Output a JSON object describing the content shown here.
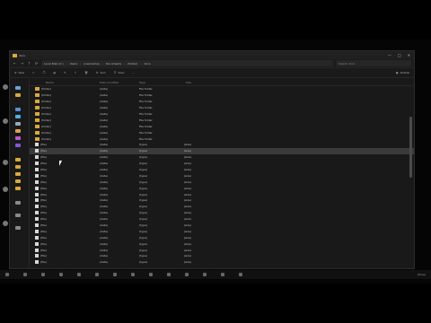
{
  "window": {
    "title": "docs",
    "min": "—",
    "max": "□",
    "close": "✕"
  },
  "address": {
    "back": "←",
    "forward": "→",
    "up": "↑",
    "refresh": "⟳",
    "crumbs": [
      "Local Disk (C:)",
      "Users",
      "(username)",
      "Documents",
      "(folder)",
      "docs"
    ],
    "search_placeholder": "Search docs"
  },
  "toolbar": {
    "new": "New",
    "sort": "Sort",
    "view": "View",
    "more": "···",
    "details": "Details"
  },
  "columns": {
    "name": "Name",
    "date": "Date modified",
    "type": "Type",
    "size": "Size"
  },
  "files": [
    {
      "kind": "folder",
      "name": "(folder)",
      "date": "(date)",
      "type": "File folder",
      "size": ""
    },
    {
      "kind": "folder",
      "name": "(folder)",
      "date": "(date)",
      "type": "File folder",
      "size": ""
    },
    {
      "kind": "folder",
      "name": "(folder)",
      "date": "(date)",
      "type": "File folder",
      "size": ""
    },
    {
      "kind": "folder",
      "name": "(folder)",
      "date": "(date)",
      "type": "File folder",
      "size": ""
    },
    {
      "kind": "folder",
      "name": "(folder)",
      "date": "(date)",
      "type": "File folder",
      "size": ""
    },
    {
      "kind": "folder",
      "name": "(folder)",
      "date": "(date)",
      "type": "File folder",
      "size": ""
    },
    {
      "kind": "folder",
      "name": "(folder)",
      "date": "(date)",
      "type": "File folder",
      "size": ""
    },
    {
      "kind": "folder",
      "name": "(folder)",
      "date": "(date)",
      "type": "File folder",
      "size": ""
    },
    {
      "kind": "folder",
      "name": "(folder)",
      "date": "(date)",
      "type": "File folder",
      "size": ""
    },
    {
      "kind": "file",
      "name": "(file)",
      "date": "(date)",
      "type": "(type)",
      "size": "(size)"
    },
    {
      "kind": "file",
      "name": "(file)",
      "date": "(date)",
      "type": "(type)",
      "size": "(size)",
      "selected": true
    },
    {
      "kind": "file",
      "name": "(file)",
      "date": "(date)",
      "type": "(type)",
      "size": "(size)"
    },
    {
      "kind": "file",
      "name": "(file)",
      "date": "(date)",
      "type": "(type)",
      "size": "(size)"
    },
    {
      "kind": "file",
      "name": "(file)",
      "date": "(date)",
      "type": "(type)",
      "size": "(size)"
    },
    {
      "kind": "file",
      "name": "(file)",
      "date": "(date)",
      "type": "(type)",
      "size": "(size)"
    },
    {
      "kind": "file",
      "name": "(file)",
      "date": "(date)",
      "type": "(type)",
      "size": "(size)"
    },
    {
      "kind": "file",
      "name": "(file)",
      "date": "(date)",
      "type": "(type)",
      "size": "(size)"
    },
    {
      "kind": "file",
      "name": "(file)",
      "date": "(date)",
      "type": "(type)",
      "size": "(size)"
    },
    {
      "kind": "file",
      "name": "(file)",
      "date": "(date)",
      "type": "(type)",
      "size": "(size)"
    },
    {
      "kind": "file",
      "name": "(file)",
      "date": "(date)",
      "type": "(type)",
      "size": "(size)"
    },
    {
      "kind": "file",
      "name": "(file)",
      "date": "(date)",
      "type": "(type)",
      "size": "(size)"
    },
    {
      "kind": "file",
      "name": "(file)",
      "date": "(date)",
      "type": "(type)",
      "size": "(size)"
    },
    {
      "kind": "file",
      "name": "(file)",
      "date": "(date)",
      "type": "(type)",
      "size": "(size)"
    },
    {
      "kind": "file",
      "name": "(file)",
      "date": "(date)",
      "type": "(type)",
      "size": "(size)"
    },
    {
      "kind": "file",
      "name": "(file)",
      "date": "(date)",
      "type": "(type)",
      "size": "(size)"
    },
    {
      "kind": "file",
      "name": "(file)",
      "date": "(date)",
      "type": "(type)",
      "size": "(size)"
    },
    {
      "kind": "file",
      "name": "(file)",
      "date": "(date)",
      "type": "(type)",
      "size": "(size)"
    },
    {
      "kind": "file",
      "name": "(file)",
      "date": "(date)",
      "type": "(type)",
      "size": "(size)"
    },
    {
      "kind": "file",
      "name": "(file)",
      "date": "(date)",
      "type": "(type)",
      "size": "(size)"
    }
  ],
  "taskbar": {
    "icons": [
      "start-icon",
      "search-icon",
      "task-view-icon",
      "file-explorer-icon",
      "browser-icon",
      "terminal-icon",
      "editor-icon",
      "settings-icon",
      "store-icon",
      "mail-icon",
      "media-icon",
      "chat-icon",
      "photos-icon",
      "notes-icon"
    ],
    "clock": "(time)"
  },
  "colors": {
    "folder": "#d9a93c",
    "window_bg": "#191919",
    "selection": "#3a3a3a"
  }
}
